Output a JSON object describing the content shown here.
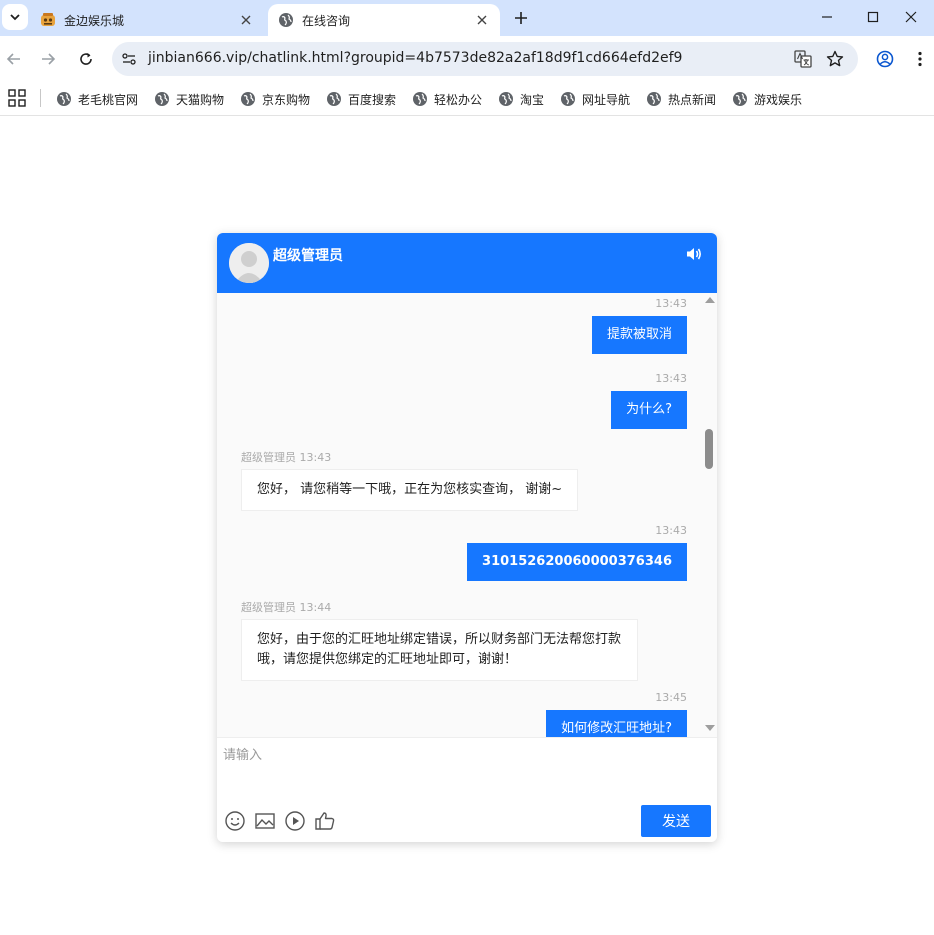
{
  "browser": {
    "tabs": [
      {
        "title": "金边娱乐城",
        "active": false,
        "icon": "casino-favicon"
      },
      {
        "title": "在线咨询",
        "active": true,
        "icon": "globe-icon"
      }
    ],
    "url": "jinbian666.vip/chatlink.html?groupid=4b7573de82a2af18d9f1cd664efd2ef9",
    "bookmarks": [
      "老毛桃官网",
      "天猫购物",
      "京东购物",
      "百度搜索",
      "轻松办公",
      "淘宝",
      "网址导航",
      "热点新闻",
      "游戏娱乐"
    ]
  },
  "chat": {
    "agent_name": "超级管理员",
    "messages": [
      {
        "direction": "out",
        "time": "13:43",
        "text": "提款被取消"
      },
      {
        "direction": "out",
        "time": "13:43",
        "text": "为什么?"
      },
      {
        "direction": "in",
        "sender": "超级管理员",
        "time": "13:43",
        "text": "您好， 请您稍等一下哦，正在为您核实查询， 谢谢~"
      },
      {
        "direction": "out",
        "time": "13:43",
        "text": "310152620060000376346"
      },
      {
        "direction": "in",
        "sender": "超级管理员",
        "time": "13:44",
        "text": "您好，由于您的汇旺地址绑定错误，所以财务部门无法帮您打款哦，请您提供您绑定的汇旺地址即可，谢谢！"
      },
      {
        "direction": "out",
        "time": "13:45",
        "text": "如何修改汇旺地址?"
      }
    ],
    "input_placeholder": "请输入",
    "send_label": "发送",
    "accent_color": "#1677ff"
  }
}
